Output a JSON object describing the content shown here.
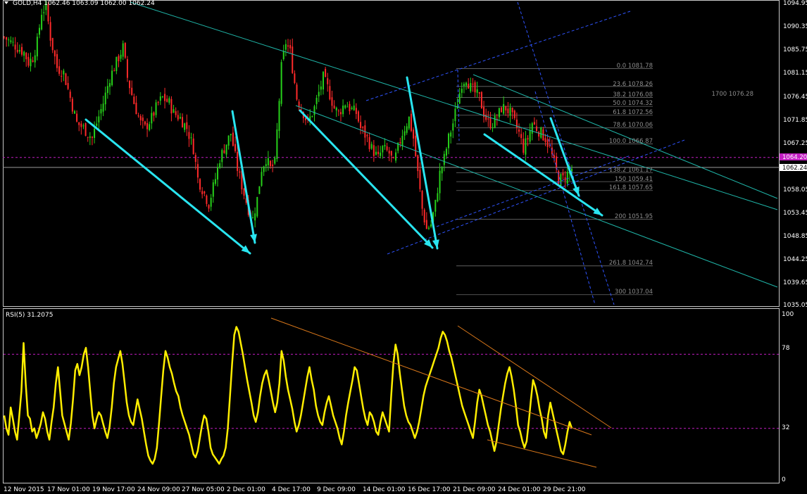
{
  "header": {
    "symbol_line": "GOLD,H4  1062.46 1063.09 1062.00 1062.24"
  },
  "rsi_header": {
    "label": "RSI(5) 31.2075"
  },
  "price_axis": {
    "ticks": [
      "1094.95",
      "1090.35",
      "1085.75",
      "1081.15",
      "1076.45",
      "1071.85",
      "1067.25",
      "1062.24",
      "1058.05",
      "1053.45",
      "1048.85",
      "1044.25",
      "1039.65",
      "1035.05"
    ],
    "ask_label": "1064.20",
    "bid_label": "1062.24"
  },
  "rsi_axis": {
    "ticks": [
      "100",
      "78",
      "32",
      "0"
    ]
  },
  "time_axis": {
    "ticks": [
      "12 Nov 2015",
      "17 Nov 01:00",
      "19 Nov 17:00",
      "24 Nov 09:00",
      "27 Nov 05:00",
      "2 Dec 01:00",
      "4 Dec 17:00",
      "9 Dec 09:00",
      "14 Dec 01:00",
      "16 Dec 17:00",
      "21 Dec 09:00",
      "24 Dec 01:00",
      "29 Dec 21:00"
    ]
  },
  "fib_levels": [
    {
      "label": "0.0  1081.78"
    },
    {
      "label": "23.6  1078.26"
    },
    {
      "label": "38.2  1076.08"
    },
    {
      "label": "50.0  1074.32"
    },
    {
      "label": "61.8  1072.56"
    },
    {
      "label": "78.6  1070.06"
    },
    {
      "label": "100.0  1066.87"
    },
    {
      "label": "138.2  1061.17"
    },
    {
      "label": "150  1059.41"
    },
    {
      "label": "161.8  1057.65"
    },
    {
      "label": "200  1051.95"
    },
    {
      "label": "261.8  1042.74"
    },
    {
      "label": "300  1037.04"
    }
  ],
  "side_label": {
    "text": "1700  1076.28"
  },
  "colors": {
    "bull": "#27d11a",
    "bear": "#ff2a2a",
    "rsi": "#ffee00",
    "arrow": "#29e5f0",
    "channel": "#2f54ff",
    "trend": "#1fb5a8",
    "rsi_trend": "#d8771a",
    "level": "#c21dc2"
  },
  "chart_data": {
    "type": "candlestick",
    "symbol": "GOLD",
    "timeframe": "H4",
    "ohlc_last": {
      "open": 1062.46,
      "high": 1063.09,
      "low": 1062.0,
      "close": 1062.24
    },
    "ylim": [
      1035.05,
      1094.95
    ],
    "x_ticks": [
      "12 Nov 2015",
      "17 Nov 01:00",
      "19 Nov 17:00",
      "24 Nov 09:00",
      "27 Nov 05:00",
      "2 Dec 01:00",
      "4 Dec 17:00",
      "9 Dec 09:00",
      "14 Dec 01:00",
      "16 Dec 17:00",
      "21 Dec 09:00",
      "24 Dec 01:00",
      "29 Dec 21:00"
    ],
    "close_path": [
      [
        0,
        1088
      ],
      [
        3,
        1087
      ],
      [
        6,
        1086
      ],
      [
        9,
        1085
      ],
      [
        11,
        1083
      ],
      [
        13,
        1084
      ],
      [
        15,
        1087
      ],
      [
        17,
        1093
      ],
      [
        19,
        1094
      ],
      [
        21,
        1088
      ],
      [
        24,
        1082
      ],
      [
        27,
        1081
      ],
      [
        30,
        1076
      ],
      [
        33,
        1071
      ],
      [
        36,
        1070
      ],
      [
        38,
        1069
      ],
      [
        40,
        1068
      ],
      [
        42,
        1071
      ],
      [
        45,
        1075
      ],
      [
        48,
        1080
      ],
      [
        51,
        1083
      ],
      [
        54,
        1086
      ],
      [
        56,
        1080
      ],
      [
        59,
        1075
      ],
      [
        62,
        1071
      ],
      [
        64,
        1070
      ],
      [
        67,
        1072
      ],
      [
        70,
        1075
      ],
      [
        72,
        1076
      ],
      [
        75,
        1075
      ],
      [
        77,
        1073
      ],
      [
        80,
        1072
      ],
      [
        83,
        1070
      ],
      [
        86,
        1066
      ],
      [
        88,
        1060
      ],
      [
        91,
        1057
      ],
      [
        93,
        1055
      ],
      [
        96,
        1060
      ],
      [
        98,
        1064
      ],
      [
        101,
        1067
      ],
      [
        103,
        1069
      ],
      [
        106,
        1062
      ],
      [
        109,
        1057
      ],
      [
        111,
        1054
      ],
      [
        113,
        1052
      ],
      [
        115,
        1056
      ],
      [
        117,
        1062
      ],
      [
        119,
        1064
      ],
      [
        121,
        1062
      ],
      [
        123,
        1063
      ],
      [
        126,
        1082
      ],
      [
        128,
        1087
      ],
      [
        130,
        1085
      ],
      [
        133,
        1076
      ],
      [
        136,
        1073
      ],
      [
        138,
        1071
      ],
      [
        141,
        1074
      ],
      [
        143,
        1077
      ],
      [
        145,
        1080
      ],
      [
        147,
        1078
      ],
      [
        150,
        1074
      ],
      [
        152,
        1073
      ],
      [
        155,
        1075
      ],
      [
        157,
        1074
      ],
      [
        160,
        1073
      ],
      [
        162,
        1070
      ],
      [
        165,
        1068
      ],
      [
        167,
        1066
      ],
      [
        170,
        1064
      ],
      [
        172,
        1066
      ],
      [
        175,
        1065
      ],
      [
        177,
        1063
      ],
      [
        179,
        1066
      ],
      [
        181,
        1069
      ],
      [
        184,
        1072
      ],
      [
        186,
        1068
      ],
      [
        188,
        1061
      ],
      [
        190,
        1054
      ],
      [
        192,
        1050
      ],
      [
        194,
        1051
      ],
      [
        196,
        1055
      ],
      [
        198,
        1061
      ],
      [
        200,
        1064
      ],
      [
        202,
        1068
      ],
      [
        204,
        1071
      ],
      [
        206,
        1075
      ],
      [
        208,
        1079
      ],
      [
        210,
        1080
      ],
      [
        212,
        1078
      ],
      [
        214,
        1077
      ],
      [
        216,
        1076
      ],
      [
        218,
        1073
      ],
      [
        220,
        1071
      ],
      [
        222,
        1071
      ],
      [
        224,
        1072
      ],
      [
        226,
        1074
      ],
      [
        228,
        1074
      ],
      [
        230,
        1073
      ],
      [
        232,
        1071
      ],
      [
        234,
        1069
      ],
      [
        236,
        1066
      ],
      [
        238,
        1068
      ],
      [
        240,
        1071
      ],
      [
        242,
        1070
      ],
      [
        244,
        1069
      ],
      [
        246,
        1068
      ],
      [
        248,
        1066
      ],
      [
        250,
        1063
      ],
      [
        252,
        1060
      ],
      [
        254,
        1060
      ],
      [
        256,
        1061
      ],
      [
        258,
        1062
      ]
    ],
    "fibonacci": [
      {
        "level": 0.0,
        "price": 1081.78
      },
      {
        "level": 23.6,
        "price": 1078.26
      },
      {
        "level": 38.2,
        "price": 1076.08
      },
      {
        "level": 50.0,
        "price": 1074.32
      },
      {
        "level": 61.8,
        "price": 1072.56
      },
      {
        "level": 78.6,
        "price": 1070.06
      },
      {
        "level": 100.0,
        "price": 1066.87
      },
      {
        "level": 138.2,
        "price": 1061.17
      },
      {
        "level": 150,
        "price": 1059.41
      },
      {
        "level": 161.8,
        "price": 1057.65
      },
      {
        "level": 200,
        "price": 1051.95
      },
      {
        "level": 261.8,
        "price": 1042.74
      },
      {
        "level": 300,
        "price": 1037.04
      }
    ],
    "current_price": 1062.24,
    "ask_price": 1064.2,
    "rsi": {
      "name": "RSI(5)",
      "current": 31.2075,
      "ylim": [
        0,
        100
      ],
      "levels": [
        78,
        32
      ],
      "values": [
        40,
        32,
        28,
        45,
        38,
        30,
        25,
        40,
        55,
        85,
        60,
        40,
        38,
        30,
        32,
        26,
        30,
        35,
        42,
        38,
        30,
        25,
        36,
        45,
        60,
        70,
        55,
        40,
        35,
        30,
        25,
        35,
        50,
        68,
        72,
        65,
        70,
        78,
        82,
        70,
        55,
        40,
        32,
        38,
        42,
        40,
        35,
        30,
        26,
        33,
        45,
        60,
        70,
        75,
        80,
        72,
        60,
        48,
        40,
        36,
        34,
        42,
        50,
        44,
        38,
        30,
        22,
        15,
        12,
        10,
        13,
        20,
        35,
        52,
        68,
        80,
        76,
        70,
        66,
        60,
        55,
        52,
        45,
        40,
        36,
        32,
        28,
        22,
        16,
        14,
        18,
        26,
        34,
        40,
        38,
        30,
        20,
        16,
        14,
        12,
        10,
        13,
        15,
        20,
        32,
        52,
        72,
        90,
        95,
        92,
        85,
        78,
        70,
        62,
        55,
        48,
        40,
        36,
        42,
        52,
        60,
        65,
        68,
        62,
        55,
        48,
        42,
        48,
        60,
        80,
        74,
        64,
        56,
        50,
        44,
        36,
        30,
        34,
        40,
        48,
        56,
        64,
        70,
        62,
        56,
        46,
        40,
        36,
        34,
        42,
        48,
        52,
        46,
        40,
        36,
        32,
        26,
        22,
        30,
        40,
        48,
        55,
        62,
        70,
        68,
        60,
        52,
        44,
        38,
        34,
        42,
        40,
        36,
        30,
        28,
        36,
        42,
        38,
        34,
        30,
        52,
        72,
        84,
        78,
        66,
        56,
        46,
        40,
        36,
        34,
        30,
        26,
        30,
        36,
        44,
        52,
        58,
        62,
        66,
        70,
        74,
        78,
        82,
        88,
        92,
        90,
        86,
        80,
        76,
        70,
        64,
        58,
        52,
        46,
        42,
        38,
        34,
        30,
        26,
        36,
        48,
        56,
        52,
        46,
        40,
        34,
        30,
        24,
        18,
        24,
        34,
        44,
        52,
        60,
        66,
        70,
        64,
        56,
        46,
        34,
        30,
        24,
        20,
        24,
        36,
        50,
        62,
        58,
        52,
        44,
        38,
        30,
        26,
        40,
        48,
        42,
        36,
        30,
        24,
        18,
        16,
        22,
        30,
        36,
        32
      ]
    }
  }
}
